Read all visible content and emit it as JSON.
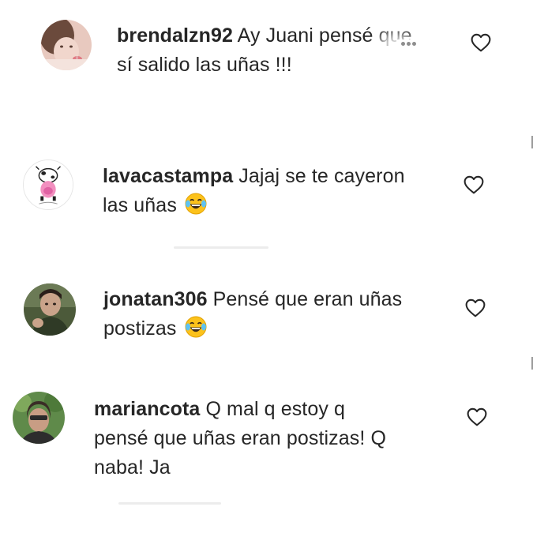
{
  "comments": [
    {
      "username": "brendalzn92",
      "text_line1": "Ay Juani pensé que",
      "text_line2": "sí salido las uñas !!!",
      "emoji": "",
      "like_icon": "heart-outline-icon"
    },
    {
      "username": "lavacastampa",
      "text_line1": "Jajaj se te cayeron",
      "text_line2": "las uñas",
      "emoji": "face-with-tears-of-joy",
      "like_icon": "heart-outline-icon"
    },
    {
      "username": "jonatan306",
      "text_line1": "Pensé que eran uñas",
      "text_line2": "postizas",
      "emoji": "face-with-tears-of-joy",
      "like_icon": "heart-outline-icon"
    },
    {
      "username": "mariancota",
      "text_line1": "Q mal q estoy q",
      "text_line2": "pensé que uñas eran postizas! Q",
      "text_line3": "naba! Ja",
      "emoji": "",
      "like_icon": "heart-outline-icon"
    }
  ],
  "colors": {
    "text": "#262626",
    "icon": "#262626",
    "muted": "#8e8e8e",
    "background": "#ffffff"
  }
}
